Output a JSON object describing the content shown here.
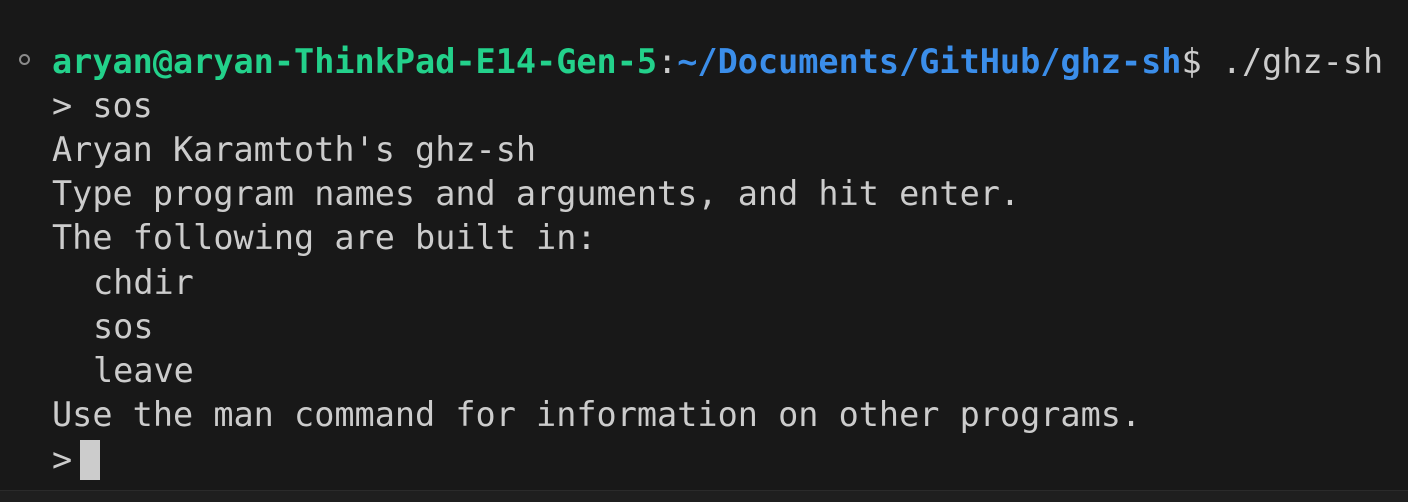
{
  "terminal": {
    "prompt": {
      "user_host": "aryan@aryan-ThinkPad-E14-Gen-5",
      "separator": ":",
      "path": "~/Documents/GitHub/ghz-sh",
      "dollar": "$ ",
      "command": "./ghz-sh"
    },
    "shell_input_1": "> sos",
    "output": {
      "title": "Aryan Karamtoth's ghz-sh",
      "instruction": "Type program names and arguments, and hit enter.",
      "builtins_header": "The following are built in:",
      "builtins": [
        "chdir",
        "sos",
        "leave"
      ],
      "man_hint": "Use the man command for information on other programs."
    },
    "shell_prompt_2": ">",
    "colors": {
      "background": "#181818",
      "text": "#cccccc",
      "user_host": "#23d18b",
      "path": "#3b8eea"
    },
    "icons": {
      "command_decoration": "circle-outline-icon",
      "cursor": "block-cursor"
    }
  }
}
